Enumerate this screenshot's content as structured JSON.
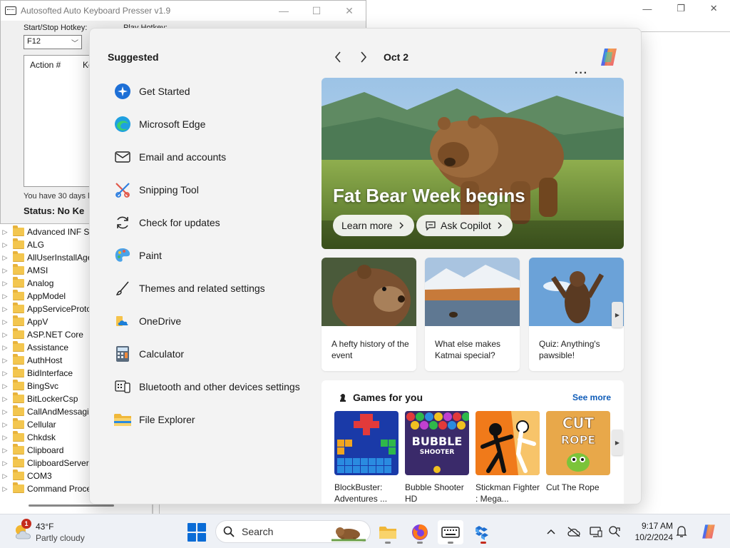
{
  "background_window": {
    "caption_buttons": [
      "—",
      "❐",
      "✕"
    ]
  },
  "keyboard_presser": {
    "title": "Autosofted Auto Keyboard Presser v1.9",
    "caption_buttons": [
      "—",
      "☐",
      "✕"
    ],
    "start_stop_label": "Start/Stop Hotkey:",
    "play_label": "Play Hotkey:",
    "hotkey_value": "F12",
    "table_header_action": "Action #",
    "table_header_key": "Ke",
    "trial_text": "You have 30 days l",
    "status_text": "Status:  No Ke"
  },
  "tree": {
    "items": [
      "Advanced INF Se",
      "ALG",
      "AllUserInstallAge",
      "AMSI",
      "Analog",
      "AppModel",
      "AppServiceProto",
      "AppV",
      "ASP.NET Core",
      "Assistance",
      "AuthHost",
      "BidInterface",
      "BingSvc",
      "BitLockerCsp",
      "CallAndMessagin",
      "Cellular",
      "Chkdsk",
      "Clipboard",
      "ClipboardServer",
      "COM3",
      "Command Proce"
    ]
  },
  "widgets": {
    "suggested_title": "Suggested",
    "suggested": [
      {
        "label": "Get Started",
        "icon": "get-started-icon"
      },
      {
        "label": "Microsoft Edge",
        "icon": "edge-icon"
      },
      {
        "label": "Email and accounts",
        "icon": "mail-icon"
      },
      {
        "label": "Snipping Tool",
        "icon": "snipping-tool-icon"
      },
      {
        "label": "Check for updates",
        "icon": "refresh-icon"
      },
      {
        "label": "Paint",
        "icon": "paint-icon"
      },
      {
        "label": "Themes and related settings",
        "icon": "brush-icon"
      },
      {
        "label": "OneDrive",
        "icon": "onedrive-icon"
      },
      {
        "label": "Calculator",
        "icon": "calculator-icon"
      },
      {
        "label": "Bluetooth and other devices settings",
        "icon": "devices-icon"
      },
      {
        "label": "File Explorer",
        "icon": "folder-icon"
      }
    ],
    "date": "Oct 2",
    "more": "···",
    "hero": {
      "title": "Fat Bear Week begins",
      "learn_more": "Learn more",
      "ask_copilot": "Ask Copilot"
    },
    "cards": [
      {
        "caption": "A hefty history of the event"
      },
      {
        "caption": "What else makes Katmai special?"
      },
      {
        "caption": "Quiz: Anything's pawsible!"
      }
    ],
    "games": {
      "title": "Games for you",
      "see_more": "See more",
      "items": [
        {
          "name": "BlockBuster: Adventures ..."
        },
        {
          "name": "Bubble Shooter HD",
          "thumb_text_1": "BUBBLE",
          "thumb_text_2": "SHOOTER"
        },
        {
          "name": "Stickman Fighter : Mega..."
        },
        {
          "name": "Cut The Rope",
          "thumb_text_1": "CUT",
          "thumb_text_2": "ROPE"
        }
      ]
    }
  },
  "taskbar": {
    "weather_temp": "43°F",
    "weather_cond": "Partly cloudy",
    "weather_badge": "1",
    "search_placeholder": "Search",
    "time": "9:17 AM",
    "date": "10/2/2024"
  },
  "colors": {
    "accent": "#0a6cd6",
    "link": "#0f5cb8",
    "badge_red": "#c42b1c"
  }
}
